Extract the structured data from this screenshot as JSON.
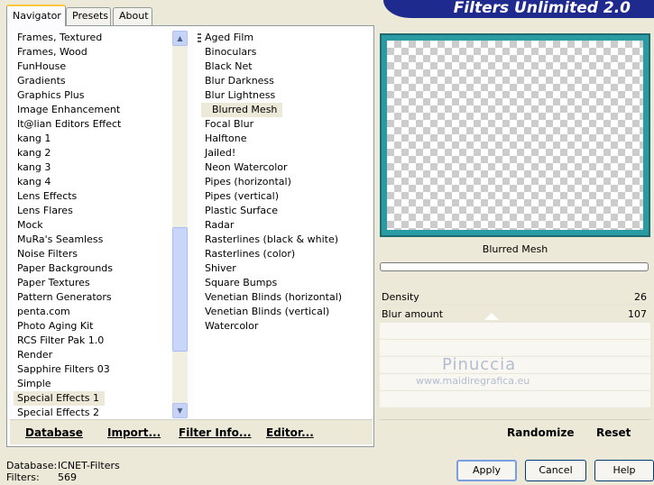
{
  "tabs": [
    {
      "label": "Navigator",
      "active": true
    },
    {
      "label": "Presets",
      "active": false
    },
    {
      "label": "About",
      "active": false
    }
  ],
  "banner": {
    "title": "Filters Unlimited 2.0"
  },
  "categories": [
    "Frames, Textured",
    "Frames, Wood",
    "FunHouse",
    "Gradients",
    "Graphics Plus",
    "Image Enhancement",
    "It@lian Editors Effect",
    "kang 1",
    "kang 2",
    "kang 3",
    "kang 4",
    "Lens Effects",
    "Lens Flares",
    "Mock",
    "MuRa's Seamless",
    "Noise Filters",
    "Paper Backgrounds",
    "Paper Textures",
    "Pattern Generators",
    "penta.com",
    "Photo Aging Kit",
    "RCS Filter Pak 1.0",
    "Render",
    "Sapphire Filters 03",
    "Simple",
    "Special Effects 1",
    "Special Effects 2"
  ],
  "selected_category": "Special Effects 1",
  "filters": [
    "Aged Film",
    "Binoculars",
    "Black Net",
    "Blur Darkness",
    "Blur Lightness",
    "Blurred Mesh",
    "Focal Blur",
    "Halftone",
    "Jailed!",
    "Neon Watercolor",
    "Pipes (horizontal)",
    "Pipes (vertical)",
    "Plastic Surface",
    "Radar",
    "Rasterlines (black & white)",
    "Rasterlines (color)",
    "Shiver",
    "Square Bumps",
    "Venetian Blinds (horizontal)",
    "Venetian Blinds (vertical)",
    "Watercolor"
  ],
  "selected_filter": "Blurred Mesh",
  "left_buttons": {
    "database": "Database",
    "import": "Import...",
    "filter_info": "Filter Info...",
    "editor": "Editor..."
  },
  "preview": {
    "filter_name": "Blurred Mesh",
    "progress": 0
  },
  "params": [
    {
      "label": "Density",
      "value": "26"
    },
    {
      "label": "Blur amount",
      "value": "107"
    }
  ],
  "watermark": {
    "name": "Pinuccia",
    "url": "www.maidiregrafica.eu"
  },
  "right_buttons": {
    "randomize": "Randomize",
    "reset": "Reset"
  },
  "status": {
    "database_label": "Database:",
    "database_value": "ICNET-Filters",
    "filters_label": "Filters:",
    "filters_value": "569"
  },
  "dialog_buttons": {
    "apply": "Apply",
    "cancel": "Cancel",
    "help": "Help"
  },
  "colors": {
    "banner": "#1e2a8e",
    "preview_frame": "#2a9ba3",
    "dialog_bg": "#ece9d8"
  }
}
